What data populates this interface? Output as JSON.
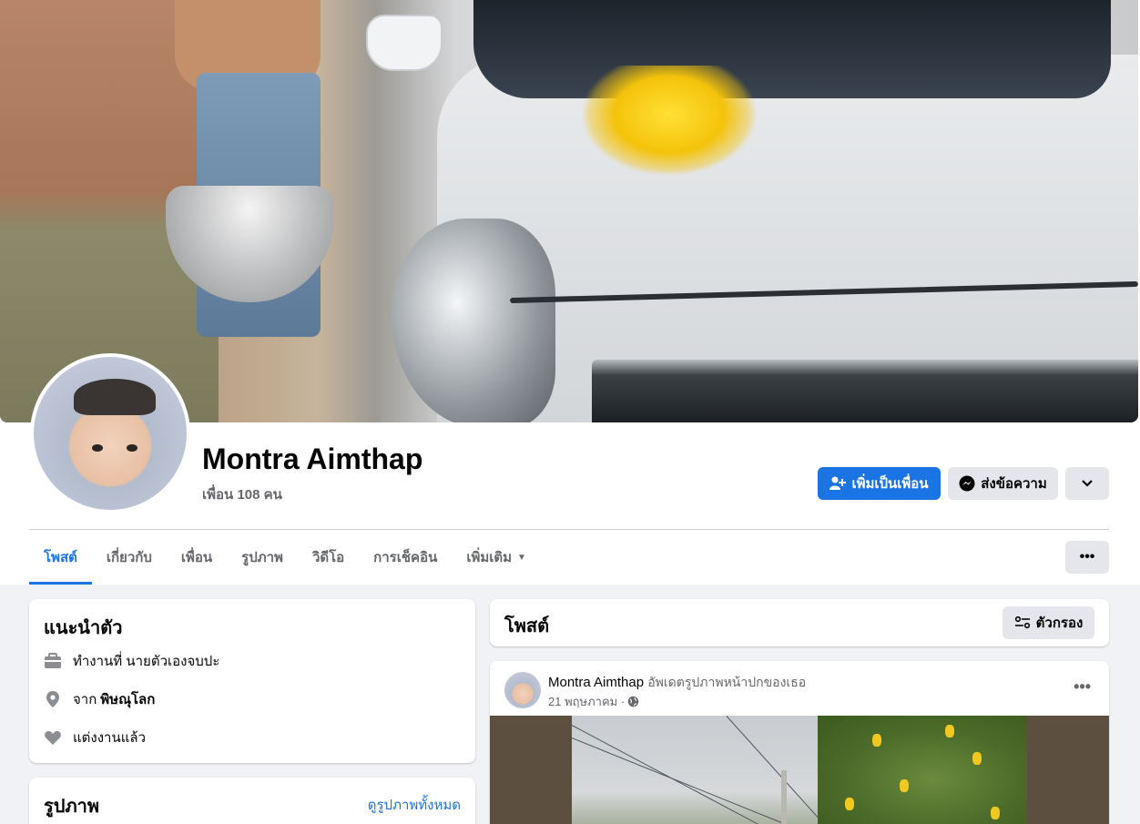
{
  "profile": {
    "name": "Montra Aimthap",
    "friends": "เพื่อน 108 คน"
  },
  "actions": {
    "add_friend": "เพิ่มเป็นเพื่อน",
    "message": "ส่งข้อความ"
  },
  "tabs": [
    {
      "label": "โพสต์",
      "active": true
    },
    {
      "label": "เกี่ยวกับ"
    },
    {
      "label": "เพื่อน"
    },
    {
      "label": "รูปภาพ"
    },
    {
      "label": "วิดีโอ"
    },
    {
      "label": "การเช็คอิน"
    },
    {
      "label": "เพิ่มเติม"
    }
  ],
  "intro": {
    "title": "แนะนำตัว",
    "work": "ทำงานที่ นายตัวเองจบปะ",
    "from_prefix": "จาก",
    "from_place": "พิษณุโลก",
    "relationship": "แต่งงานแล้ว"
  },
  "photos": {
    "title": "รูปภาพ",
    "see_all": "ดูรูปภาพทั้งหมด"
  },
  "posts": {
    "title": "โพสต์",
    "filter_label": "ตัวกรอง"
  },
  "post": {
    "author": "Montra Aimthap",
    "action": "อัพเดตรูปภาพหน้าปกของเธอ",
    "date": "21 พฤษภาคม ·"
  },
  "colors": {
    "accent": "#1b74e4",
    "background": "#f0f2f5",
    "secondary_button": "#e4e6eb"
  }
}
